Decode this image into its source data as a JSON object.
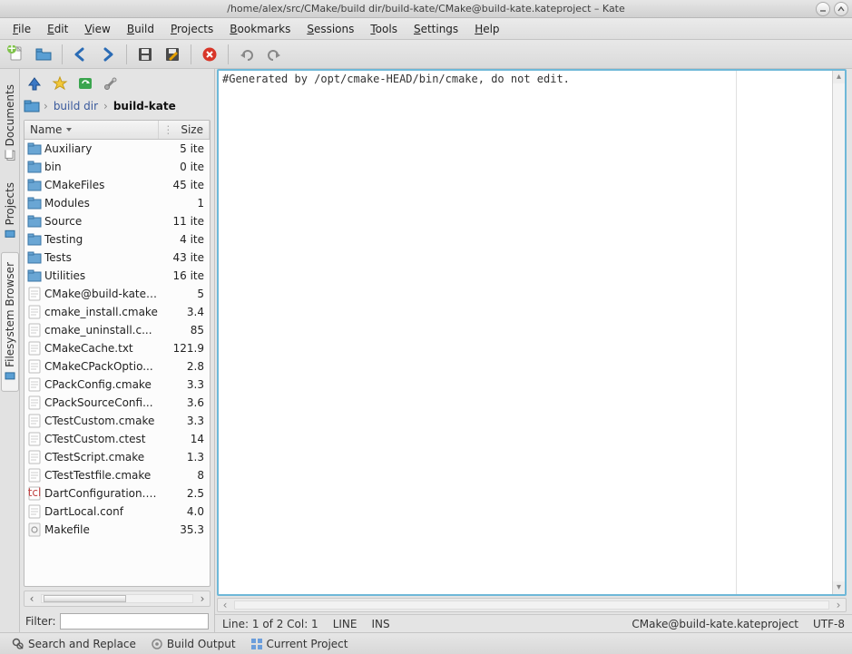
{
  "window": {
    "title": "/home/alex/src/CMake/build dir/build-kate/CMake@build-kate.kateproject – Kate"
  },
  "menu": {
    "items": [
      "File",
      "Edit",
      "View",
      "Build",
      "Projects",
      "Bookmarks",
      "Sessions",
      "Tools",
      "Settings",
      "Help"
    ]
  },
  "sidetabs": {
    "documents": "Documents",
    "projects": "Projects",
    "fsbrowser": "Filesystem Browser"
  },
  "breadcrumb": {
    "items": [
      "build dir",
      "build-kate"
    ]
  },
  "filelist": {
    "header_name": "Name",
    "header_size": "Size",
    "rows": [
      {
        "type": "folder",
        "name": "Auxiliary",
        "size": "5 ite"
      },
      {
        "type": "folder",
        "name": "bin",
        "size": "0 ite"
      },
      {
        "type": "folder",
        "name": "CMakeFiles",
        "size": "45 ite"
      },
      {
        "type": "folder",
        "name": "Modules",
        "size": "1"
      },
      {
        "type": "folder",
        "name": "Source",
        "size": "11 ite"
      },
      {
        "type": "folder",
        "name": "Testing",
        "size": "4 ite"
      },
      {
        "type": "folder",
        "name": "Tests",
        "size": "43 ite"
      },
      {
        "type": "folder",
        "name": "Utilities",
        "size": "16 ite"
      },
      {
        "type": "file",
        "name": "CMake@build-kate....",
        "size": "5"
      },
      {
        "type": "file",
        "name": "cmake_install.cmake",
        "size": "3.4"
      },
      {
        "type": "file",
        "name": "cmake_uninstall.c...",
        "size": "85"
      },
      {
        "type": "file",
        "name": "CMakeCache.txt",
        "size": "121.9"
      },
      {
        "type": "file",
        "name": "CMakeCPackOptio...",
        "size": "2.8"
      },
      {
        "type": "file",
        "name": "CPackConfig.cmake",
        "size": "3.3"
      },
      {
        "type": "file",
        "name": "CPackSourceConfi...",
        "size": "3.6"
      },
      {
        "type": "file",
        "name": "CTestCustom.cmake",
        "size": "3.3"
      },
      {
        "type": "file",
        "name": "CTestCustom.ctest",
        "size": "14"
      },
      {
        "type": "file",
        "name": "CTestScript.cmake",
        "size": "1.3"
      },
      {
        "type": "file",
        "name": "CTestTestfile.cmake",
        "size": "8"
      },
      {
        "type": "tcl",
        "name": "DartConfiguration.tcl",
        "size": "2.5"
      },
      {
        "type": "file",
        "name": "DartLocal.conf",
        "size": "4.0"
      },
      {
        "type": "make",
        "name": "Makefile",
        "size": "35.3"
      }
    ]
  },
  "filter": {
    "label": "Filter:",
    "value": ""
  },
  "editor": {
    "content": "#Generated by /opt/cmake-HEAD/bin/cmake, do not edit."
  },
  "status": {
    "linecol": "Line: 1 of 2 Col: 1",
    "linemode": "LINE",
    "insmode": "INS",
    "filename": "CMake@build-kate.kateproject",
    "encoding": "UTF-8"
  },
  "bottom": {
    "search_replace": "Search and Replace",
    "build_output": "Build Output",
    "current_project": "Current Project"
  }
}
